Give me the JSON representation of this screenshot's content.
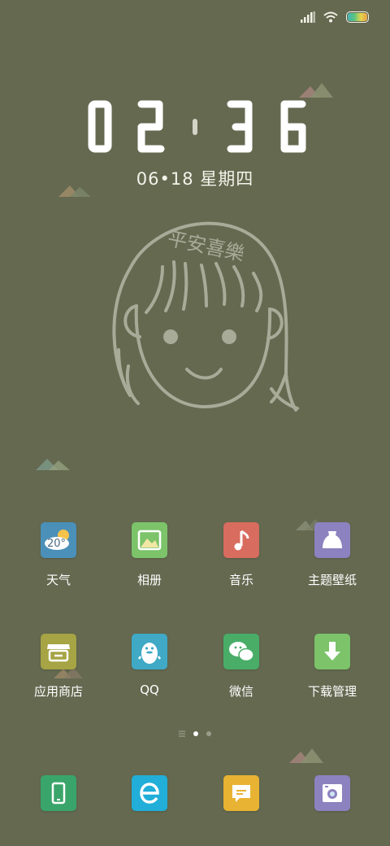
{
  "status_bar": {
    "icons": [
      "signal-icon",
      "wifi-icon",
      "battery-icon"
    ]
  },
  "clock": {
    "hours": "02",
    "minutes": "36"
  },
  "date": {
    "text": "06•18 星期四"
  },
  "wallpaper": {
    "illustration_text": "平安喜樂"
  },
  "apps": [
    {
      "label": "天气",
      "icon": "weather-icon",
      "color": "#4a90b8",
      "badge": "20°"
    },
    {
      "label": "相册",
      "icon": "gallery-icon",
      "color": "#7cc36a"
    },
    {
      "label": "音乐",
      "icon": "music-icon",
      "color": "#d86c5e"
    },
    {
      "label": "主题壁纸",
      "icon": "theme-icon",
      "color": "#8c82bf"
    },
    {
      "label": "应用商店",
      "icon": "store-icon",
      "color": "#a6a444"
    },
    {
      "label": "QQ",
      "icon": "qq-icon",
      "color": "#3fa9c6"
    },
    {
      "label": "微信",
      "icon": "wechat-icon",
      "color": "#49ad68"
    },
    {
      "label": "下载管理",
      "icon": "download-icon",
      "color": "#7cc36a"
    }
  ],
  "pager": {
    "pages": 3,
    "active": 1
  },
  "dock": [
    {
      "icon": "phone-icon",
      "color": "#3aa56a"
    },
    {
      "icon": "browser-icon",
      "color": "#21aed8"
    },
    {
      "icon": "messages-icon",
      "color": "#e8b332"
    },
    {
      "icon": "camera-icon",
      "color": "#8c82bf"
    }
  ]
}
